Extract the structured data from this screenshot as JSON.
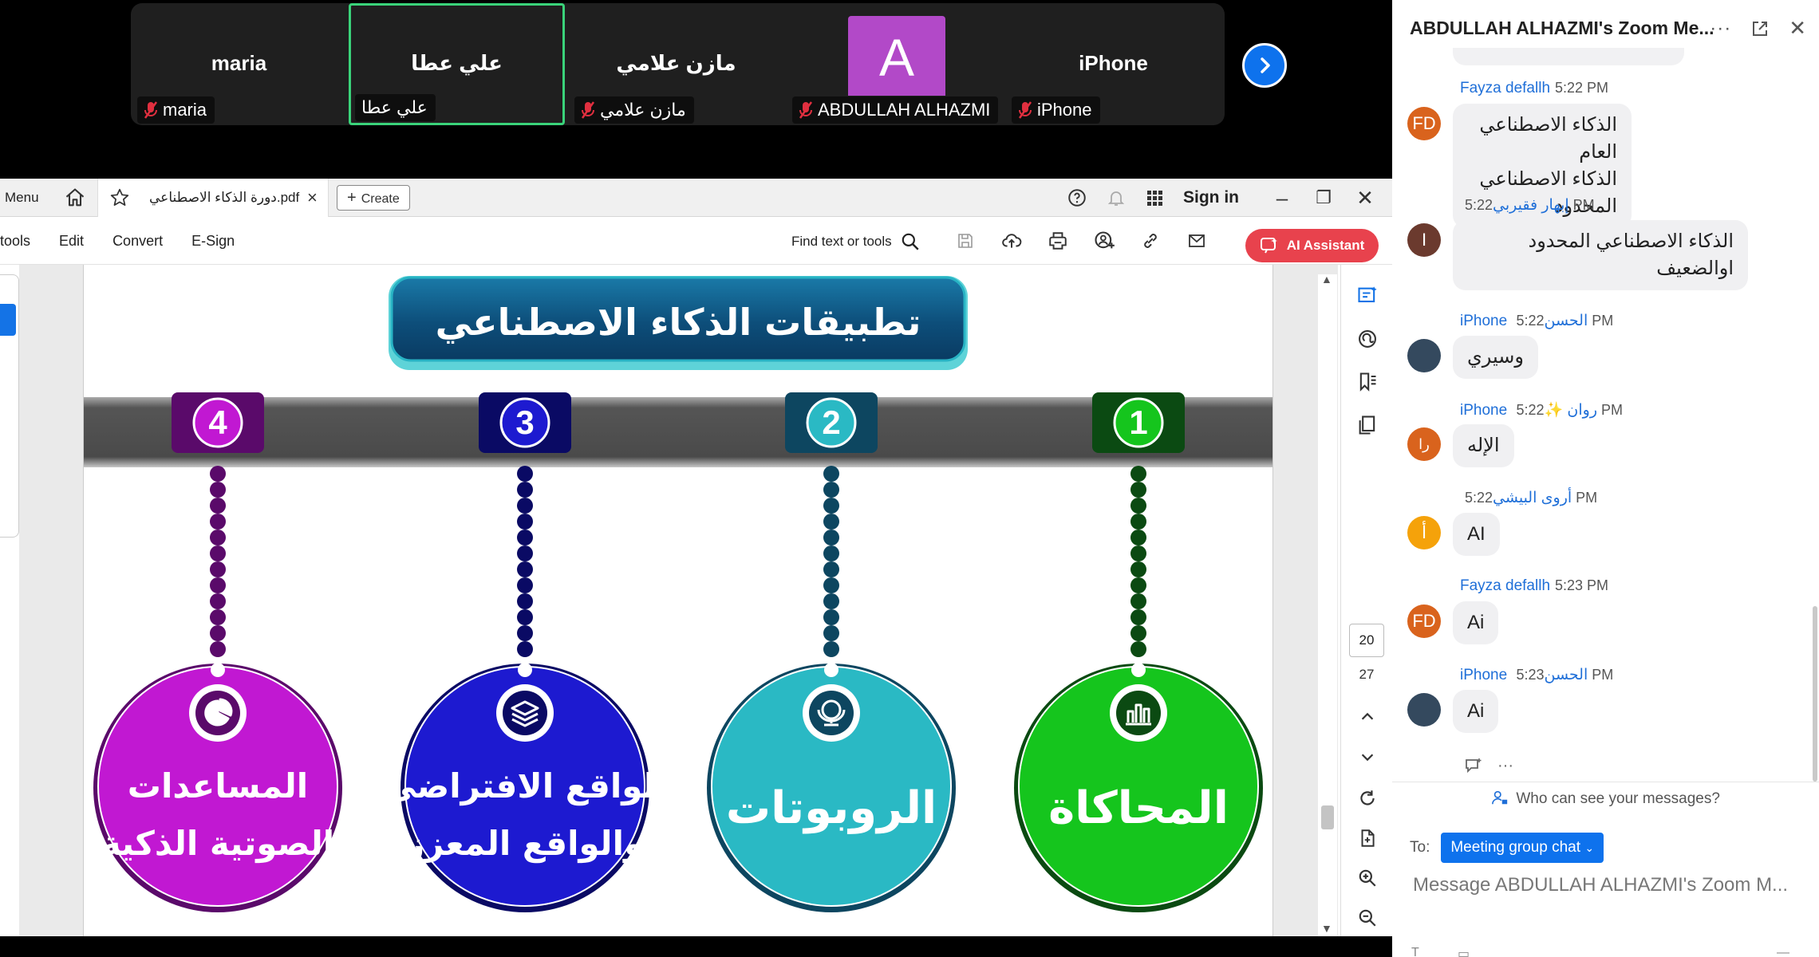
{
  "video": {
    "tiles": [
      {
        "name": "maria",
        "label": "maria",
        "muted": true
      },
      {
        "name": "علي عطا",
        "label": "علي عطا",
        "muted": false
      },
      {
        "name": "مازن علامي",
        "label": "مازن علامي",
        "muted": true
      },
      {
        "name": "",
        "label": "ABDULLAH ALHAZMI",
        "muted": true,
        "avatar_letter": "A"
      },
      {
        "name": "iPhone",
        "label": "iPhone",
        "muted": true
      }
    ]
  },
  "acrobat": {
    "menu_label": "Menu",
    "tab_title": "دورة الذكاء الاصطناعي.pdf",
    "create_label": "Create",
    "sign_in": "Sign in",
    "menus": [
      "tools",
      "Edit",
      "Convert",
      "E-Sign"
    ],
    "find_label": "Find text or tools",
    "ai_assistant": "AI Assistant",
    "page_current": "20",
    "page_total": "27"
  },
  "slide": {
    "title": "تطبيقات الذكاء الاصطناعي",
    "items": [
      {
        "number": "1",
        "label_line1": "المحاكاة",
        "label_line2": "",
        "color": "#15c51d",
        "dark": "#0b4a12",
        "icon": "bar-chart-icon"
      },
      {
        "number": "2",
        "label_line1": "الروبوتات",
        "label_line2": "",
        "color": "#2ab9c4",
        "dark": "#0d4660",
        "icon": "globe-icon"
      },
      {
        "number": "3",
        "label_line1": "الواقع الافتراضي",
        "label_line2": "والواقع المعزز",
        "color": "#1d1ad0",
        "dark": "#0a0a64",
        "icon": "layers-icon"
      },
      {
        "number": "4",
        "label_line1": "المساعدات",
        "label_line2": "الصوتية الذكية",
        "color": "#c118d2",
        "dark": "#5a0a6a",
        "icon": "pie-chart-icon"
      }
    ]
  },
  "chat": {
    "title": "ABDULLAH ALHAZMI's Zoom Me...",
    "messages": [
      {
        "name": "Fayza defallh",
        "time": "5:22 PM",
        "initials": "FD",
        "avatar_color": "#d9631d",
        "text": "الذكاء الاصطناعي العام\nالذكاء الاصطناعي المحدود"
      },
      {
        "name": "إبهار فقيربي",
        "time": "5:22 PM",
        "initials": "I",
        "avatar_color": "#6b3a2e",
        "text": "الذكاء الاصطناعي المحدود\nاوالضعيف"
      },
      {
        "name": "iPhone الحسن",
        "time": "5:22 PM",
        "initials": "",
        "avatar_color": "#34495e",
        "text": "وسيري"
      },
      {
        "name": "iPhone روان ✨",
        "time": "5:22 PM",
        "initials": "را",
        "avatar_color": "#d9631d",
        "text": "الإله"
      },
      {
        "name": "أروى البيشي",
        "time": "5:22 PM",
        "initials": "أ",
        "avatar_color": "#f5a20a",
        "text": "AI"
      },
      {
        "name": "Fayza defallh",
        "time": "5:23 PM",
        "initials": "FD",
        "avatar_color": "#d9631d",
        "text": "Ai"
      },
      {
        "name": "iPhone الحسن",
        "time": "5:23 PM",
        "initials": "",
        "avatar_color": "#34495e",
        "text": "Ai"
      }
    ],
    "who_can_see": "Who can see your messages?",
    "to_label": "To:",
    "to_target": "Meeting group chat",
    "input_placeholder": "Message ABDULLAH ALHAZMI's Zoom M..."
  }
}
